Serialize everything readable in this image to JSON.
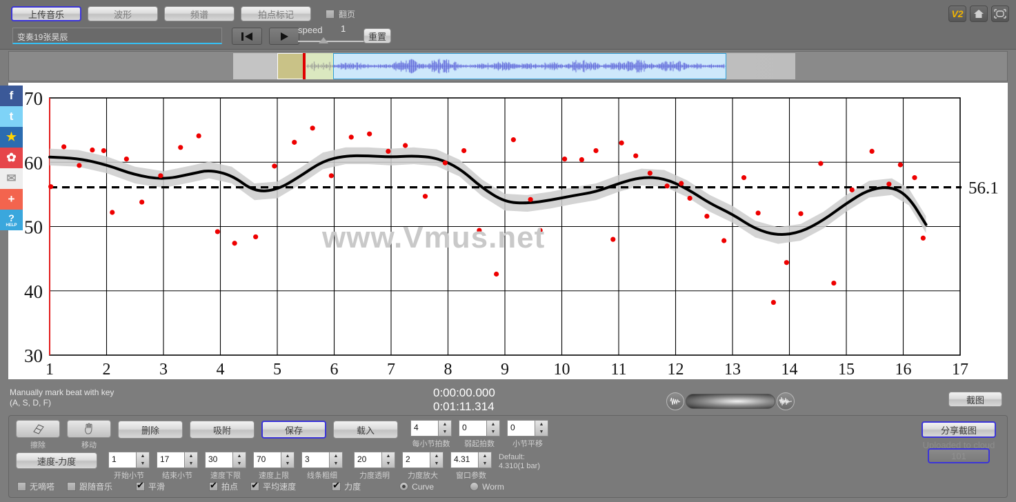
{
  "toolbar": {
    "buttons": [
      {
        "label": "上传音乐",
        "selected": true
      },
      {
        "label": "波形",
        "selected": false
      },
      {
        "label": "频谱",
        "selected": false
      },
      {
        "label": "拍点标记",
        "selected": false
      }
    ],
    "page_turn_label": "翻页",
    "page_turn_checked": false
  },
  "transport": {
    "song_value": "变奏19张昊辰",
    "song_placeholder": "",
    "rewind_icon": "rewind-to-start-icon",
    "play_icon": "play-icon",
    "speed_label": "speed",
    "speed_value": "1",
    "reset_label": "重置"
  },
  "badges": {
    "version": "V2",
    "home_icon": "home-icon",
    "fullscreen_icon": "fullscreen-icon"
  },
  "social": [
    {
      "name": "facebook",
      "glyph": "f"
    },
    {
      "name": "twitter",
      "glyph": "t"
    },
    {
      "name": "qzone",
      "glyph": "★"
    },
    {
      "name": "weibo",
      "glyph": "✿"
    },
    {
      "name": "email",
      "glyph": "✉"
    },
    {
      "name": "share-more",
      "glyph": "+"
    },
    {
      "name": "help",
      "glyph": "?",
      "sub": "HELP"
    }
  ],
  "chart_data": {
    "type": "scatter",
    "title": "",
    "xlabel": "",
    "ylabel": "",
    "xlim": [
      1,
      17
    ],
    "ylim": [
      30,
      70
    ],
    "xticks": [
      1,
      2,
      3,
      4,
      5,
      6,
      7,
      8,
      9,
      10,
      11,
      12,
      13,
      14,
      15,
      16,
      17
    ],
    "yticks": [
      30,
      40,
      50,
      60,
      70
    ],
    "grid": true,
    "legend": "none",
    "mean_line_value": 56.1,
    "mean_line_label": "56.1",
    "watermark": "www.Vmus.net",
    "point_color": "#ee0000",
    "curve_color": "#000000",
    "band_color": "#cccccc",
    "scatter": [
      [
        1.02,
        56.2
      ],
      [
        1.25,
        62.4
      ],
      [
        1.52,
        59.5
      ],
      [
        1.75,
        61.9
      ],
      [
        1.95,
        61.8
      ],
      [
        2.1,
        52.2
      ],
      [
        2.35,
        60.5
      ],
      [
        2.62,
        53.8
      ],
      [
        2.95,
        57.9
      ],
      [
        3.3,
        62.3
      ],
      [
        3.62,
        64.1
      ],
      [
        3.95,
        49.2
      ],
      [
        4.25,
        47.4
      ],
      [
        4.62,
        48.4
      ],
      [
        4.95,
        59.4
      ],
      [
        5.3,
        63.1
      ],
      [
        5.62,
        65.3
      ],
      [
        5.95,
        57.9
      ],
      [
        6.3,
        63.9
      ],
      [
        6.62,
        64.4
      ],
      [
        6.95,
        61.7
      ],
      [
        7.25,
        62.6
      ],
      [
        7.6,
        54.7
      ],
      [
        7.95,
        59.9
      ],
      [
        8.28,
        61.8
      ],
      [
        8.55,
        49.4
      ],
      [
        8.85,
        42.6
      ],
      [
        9.15,
        63.5
      ],
      [
        9.45,
        54.2
      ],
      [
        9.62,
        49.4
      ],
      [
        10.05,
        60.5
      ],
      [
        10.35,
        60.4
      ],
      [
        10.6,
        61.8
      ],
      [
        10.9,
        48.0
      ],
      [
        11.05,
        63.0
      ],
      [
        11.3,
        61.0
      ],
      [
        11.55,
        58.3
      ],
      [
        11.85,
        56.3
      ],
      [
        12.1,
        56.7
      ],
      [
        12.25,
        54.4
      ],
      [
        12.55,
        51.6
      ],
      [
        12.85,
        47.8
      ],
      [
        13.2,
        57.6
      ],
      [
        13.45,
        52.1
      ],
      [
        13.72,
        38.2
      ],
      [
        13.95,
        44.4
      ],
      [
        14.2,
        52.0
      ],
      [
        14.55,
        59.8
      ],
      [
        14.78,
        41.2
      ],
      [
        15.1,
        55.7
      ],
      [
        15.45,
        61.7
      ],
      [
        15.75,
        56.6
      ],
      [
        15.95,
        59.6
      ],
      [
        16.2,
        57.6
      ],
      [
        16.35,
        48.2
      ]
    ],
    "curve": [
      [
        1.0,
        60.8
      ],
      [
        1.5,
        60.6
      ],
      [
        2.0,
        59.6
      ],
      [
        2.5,
        58.0
      ],
      [
        3.0,
        57.3
      ],
      [
        3.5,
        58.2
      ],
      [
        3.8,
        58.8
      ],
      [
        4.2,
        58.0
      ],
      [
        4.6,
        55.4
      ],
      [
        5.0,
        55.7
      ],
      [
        5.4,
        57.8
      ],
      [
        5.8,
        60.2
      ],
      [
        6.2,
        61.0
      ],
      [
        6.6,
        61.0
      ],
      [
        7.0,
        60.8
      ],
      [
        7.4,
        61.0
      ],
      [
        7.8,
        60.7
      ],
      [
        8.2,
        59.1
      ],
      [
        8.6,
        56.0
      ],
      [
        9.0,
        53.8
      ],
      [
        9.4,
        53.6
      ],
      [
        9.8,
        54.1
      ],
      [
        10.2,
        54.8
      ],
      [
        10.6,
        55.4
      ],
      [
        11.0,
        56.7
      ],
      [
        11.4,
        57.7
      ],
      [
        11.8,
        57.5
      ],
      [
        12.2,
        55.9
      ],
      [
        12.6,
        53.6
      ],
      [
        13.0,
        51.9
      ],
      [
        13.4,
        49.6
      ],
      [
        13.8,
        48.6
      ],
      [
        14.2,
        49.1
      ],
      [
        14.6,
        51.0
      ],
      [
        15.0,
        53.6
      ],
      [
        15.4,
        55.8
      ],
      [
        15.8,
        56.2
      ],
      [
        16.1,
        54.6
      ],
      [
        16.4,
        50.3
      ]
    ],
    "band_halfwidth": 1.3
  },
  "info": {
    "hint_line1": "Manually mark beat with key",
    "hint_line2": "(A, S, D, F)",
    "time_current": "0:00:00.000",
    "time_total": "0:01:11.314",
    "volume_icon_left": "waveform-small-icon",
    "volume_icon_right": "waveform-large-icon",
    "screenshot_label": "截图"
  },
  "bottom": {
    "tool_buttons": [
      {
        "label": "擦除",
        "icon": "eraser-icon"
      },
      {
        "label": "移动",
        "icon": "hand-move-icon"
      }
    ],
    "action_buttons": [
      {
        "label": "删除",
        "selected": false
      },
      {
        "label": "吸附",
        "selected": false
      },
      {
        "label": "保存",
        "selected": true
      },
      {
        "label": "载入",
        "selected": false
      }
    ],
    "mode_button": "速度-力度",
    "spinners_row1": [
      {
        "value": "4",
        "label": "每小节拍数"
      },
      {
        "value": "0",
        "label": "弱起拍数"
      },
      {
        "value": "0",
        "label": "小节平移"
      }
    ],
    "spinners_row2": [
      {
        "value": "1",
        "label": "开始小节"
      },
      {
        "value": "17",
        "label": "结束小节"
      },
      {
        "value": "30",
        "label": "速度下限"
      },
      {
        "value": "70",
        "label": "速度上限"
      },
      {
        "value": "3",
        "label": "线条粗细"
      },
      {
        "value": "20",
        "label": "力度透明"
      },
      {
        "value": "2",
        "label": "力度放大"
      },
      {
        "value": "4.31",
        "label": "窗口参数"
      }
    ],
    "default_note_line1": "Default:",
    "default_note_line2": "4.310(1 bar)",
    "checkboxes": [
      {
        "label": "无嘀嗒",
        "checked": false
      },
      {
        "label": "跟随音乐",
        "checked": false
      },
      {
        "label": "平滑",
        "checked": true
      },
      {
        "label": "拍点",
        "checked": true
      },
      {
        "label": "平均速度",
        "checked": true
      },
      {
        "label": "力度",
        "checked": true
      }
    ],
    "radios": [
      {
        "label": "Curve",
        "checked": true
      },
      {
        "label": "Worm",
        "checked": false
      }
    ],
    "share_label": "分享截图",
    "cloud_label": "Uploaded to cloud",
    "cloud_id": "101"
  }
}
